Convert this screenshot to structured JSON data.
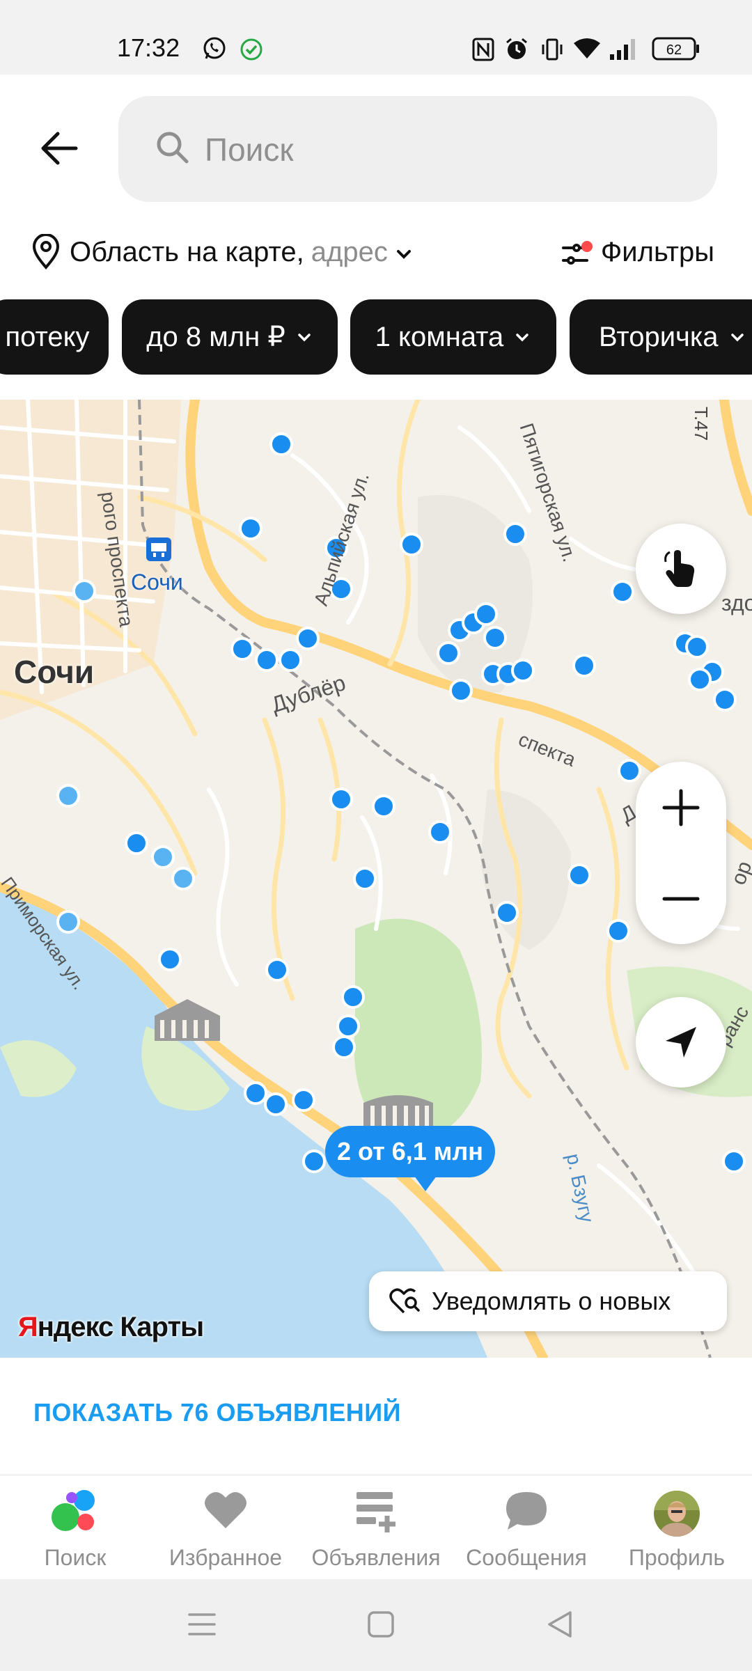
{
  "status_bar": {
    "time": "17:32",
    "battery": "62",
    "icons": [
      "whatsapp-icon",
      "check-circle-icon",
      "nfc-icon",
      "alarm-icon",
      "vibrate-icon",
      "wifi-icon",
      "signal-icon",
      "battery-icon"
    ]
  },
  "search": {
    "placeholder": "Поиск",
    "value": ""
  },
  "location": {
    "main": "Область на карте,",
    "sub": "адрес"
  },
  "filters": {
    "label": "Фильтры"
  },
  "chips": [
    {
      "label": "потеку"
    },
    {
      "label": "до 8 млн ₽"
    },
    {
      "label": "1 комната"
    },
    {
      "label": "Вторичка"
    }
  ],
  "map": {
    "city_label": "Сочи",
    "metro_label": "Сочи",
    "street_labels": {
      "s1": "рого проспекта",
      "s2": "Альпийская ул.",
      "s3": "Пятигорская ул.",
      "s4": "Дублёр",
      "s5": "спекта",
      "s6": "Приморская ул.",
      "s7": "р. Бзугу",
      "s8": "Д",
      "s9": "здо",
      "s10": "ранс",
      "s11": "ор",
      "s12": "Т.47"
    },
    "price_bubble": "2 от 6,1 млн",
    "notify_label": "Уведомлять о новых",
    "logo_ya": "Я",
    "logo_rest": "ндекс Карты",
    "colors": {
      "water": "#b7dcf3",
      "park": "#cde8b8",
      "road_major": "#ffd37a",
      "marker": "#1a8df0",
      "marker_light": "#59b3f3"
    }
  },
  "show_button": {
    "label": "ПОКАЗАТЬ 76 ОБЪЯВЛЕНИЙ"
  },
  "bottom_nav": {
    "items": [
      {
        "label": "Поиск",
        "icon": "search-dots-icon"
      },
      {
        "label": "Избранное",
        "icon": "heart-icon"
      },
      {
        "label": "Объявления",
        "icon": "add-listing-icon"
      },
      {
        "label": "Сообщения",
        "icon": "chat-bubble-icon"
      },
      {
        "label": "Профиль",
        "icon": "avatar"
      }
    ]
  }
}
